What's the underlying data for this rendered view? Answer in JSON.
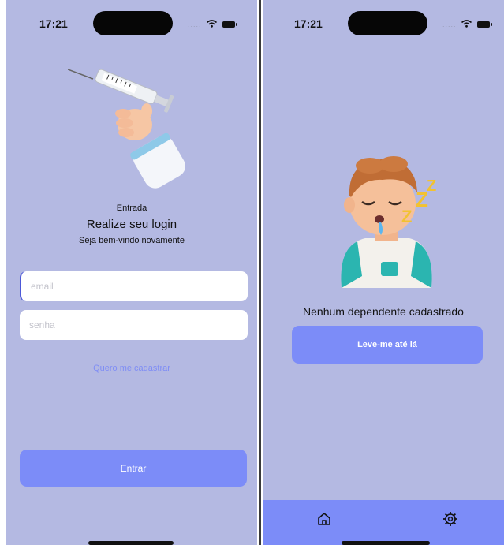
{
  "login_screen": {
    "status_bar": {
      "time": "17:21",
      "signal": "....."
    },
    "illustration_icon": "syringe-hand-illustration",
    "caption": "Entrada",
    "title": "Realize seu login",
    "subtitle": "Seja bem-vindo novamente",
    "email_field": {
      "value": "",
      "placeholder": "email"
    },
    "password_field": {
      "value": "",
      "placeholder": "senha"
    },
    "register_link": "Quero me cadastrar",
    "submit_button": "Entrar"
  },
  "empty_screen": {
    "status_bar": {
      "time": "17:21",
      "signal": "....."
    },
    "illustration_icon": "sleeping-boy-illustration",
    "message": "Nenhum dependente cadastrado",
    "action_button": "Leve-me até lá",
    "tab_bar": [
      {
        "icon": "home-icon"
      },
      {
        "icon": "gear-icon"
      }
    ]
  },
  "colors": {
    "background": "#b4b9e2",
    "accent": "#7c8cf8",
    "link": "#7f8df5"
  }
}
